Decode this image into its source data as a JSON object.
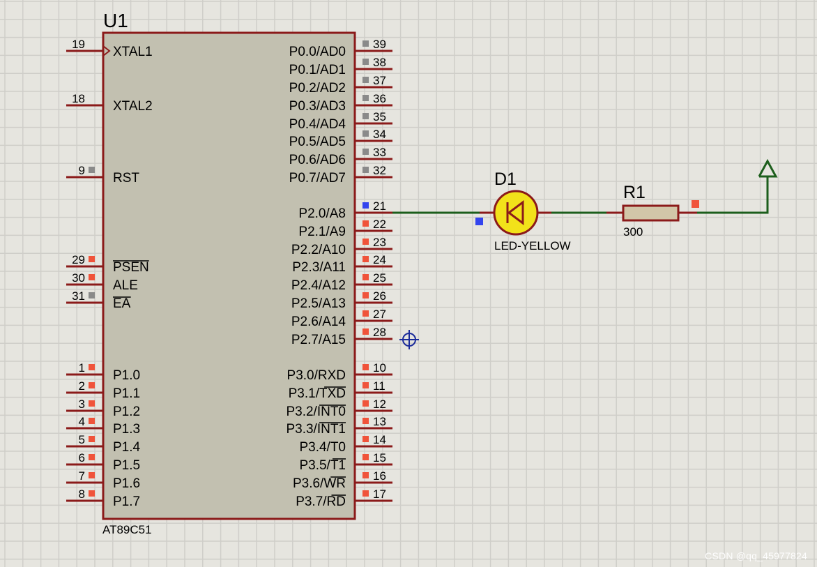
{
  "colors": {
    "background": "#e6e5df",
    "grid": "#cfcec9",
    "chip_fill": "#c2c0b0",
    "chip_border": "#8b1a1a",
    "pin": "#8b1a1a",
    "wire": "#1c5e1c",
    "pin_state_gray": "#8a8a8a",
    "pin_state_red": "#f0533a",
    "pin_state_blue": "#3344ee",
    "led_fill": "#f2e21a",
    "resistor_fill": "#d2c6a8"
  },
  "chip": {
    "ref": "U1",
    "part": "AT89C51",
    "left_pins": [
      {
        "num": "19",
        "label": "XTAL1",
        "state": "none",
        "clock": true
      },
      {
        "num": "18",
        "label": "XTAL2",
        "state": "none"
      },
      {
        "num": "9",
        "label": "RST",
        "state": "gray"
      },
      {
        "num": "29",
        "label": "PSEN",
        "state": "red",
        "overline": "PSEN"
      },
      {
        "num": "30",
        "label": "ALE",
        "state": "red"
      },
      {
        "num": "31",
        "label": "EA",
        "state": "gray",
        "overline": "EA"
      },
      {
        "num": "1",
        "label": "P1.0",
        "state": "red"
      },
      {
        "num": "2",
        "label": "P1.1",
        "state": "red"
      },
      {
        "num": "3",
        "label": "P1.2",
        "state": "red"
      },
      {
        "num": "4",
        "label": "P1.3",
        "state": "red"
      },
      {
        "num": "5",
        "label": "P1.4",
        "state": "red"
      },
      {
        "num": "6",
        "label": "P1.5",
        "state": "red"
      },
      {
        "num": "7",
        "label": "P1.6",
        "state": "red"
      },
      {
        "num": "8",
        "label": "P1.7",
        "state": "red"
      }
    ],
    "right_pins": [
      {
        "num": "39",
        "label": "P0.0/AD0",
        "state": "gray"
      },
      {
        "num": "38",
        "label": "P0.1/AD1",
        "state": "gray"
      },
      {
        "num": "37",
        "label": "P0.2/AD2",
        "state": "gray"
      },
      {
        "num": "36",
        "label": "P0.3/AD3",
        "state": "gray"
      },
      {
        "num": "35",
        "label": "P0.4/AD4",
        "state": "gray"
      },
      {
        "num": "34",
        "label": "P0.5/AD5",
        "state": "gray"
      },
      {
        "num": "33",
        "label": "P0.6/AD6",
        "state": "gray"
      },
      {
        "num": "32",
        "label": "P0.7/AD7",
        "state": "gray"
      },
      {
        "num": "21",
        "label": "P2.0/A8",
        "state": "blue"
      },
      {
        "num": "22",
        "label": "P2.1/A9",
        "state": "red"
      },
      {
        "num": "23",
        "label": "P2.2/A10",
        "state": "red"
      },
      {
        "num": "24",
        "label": "P2.3/A11",
        "state": "red"
      },
      {
        "num": "25",
        "label": "P2.4/A12",
        "state": "red"
      },
      {
        "num": "26",
        "label": "P2.5/A13",
        "state": "red"
      },
      {
        "num": "27",
        "label": "P2.6/A14",
        "state": "red"
      },
      {
        "num": "28",
        "label": "P2.7/A15",
        "state": "red"
      },
      {
        "num": "10",
        "label": "P3.0/RXD",
        "state": "red"
      },
      {
        "num": "11",
        "label": "P3.1/TXD",
        "state": "red",
        "overline": "TXD"
      },
      {
        "num": "12",
        "label": "P3.2/INT0",
        "state": "red",
        "overline": "INT0"
      },
      {
        "num": "13",
        "label": "P3.3/INT1",
        "state": "red",
        "overline": "INT1"
      },
      {
        "num": "14",
        "label": "P3.4/T0",
        "state": "red"
      },
      {
        "num": "15",
        "label": "P3.5/T1",
        "state": "red",
        "overline": "T1"
      },
      {
        "num": "16",
        "label": "P3.6/WR",
        "state": "red",
        "overline": "WR"
      },
      {
        "num": "17",
        "label": "P3.7/RD",
        "state": "red",
        "overline": "RD"
      }
    ]
  },
  "led": {
    "ref": "D1",
    "value": "LED-YELLOW",
    "state_left": "blue"
  },
  "resistor": {
    "ref": "R1",
    "value": "300",
    "state_right": "red"
  },
  "power": {
    "name": "power-terminal"
  },
  "cursor": {
    "name": "crosshair-cursor"
  },
  "watermark": "CSDN @qq_45977824"
}
